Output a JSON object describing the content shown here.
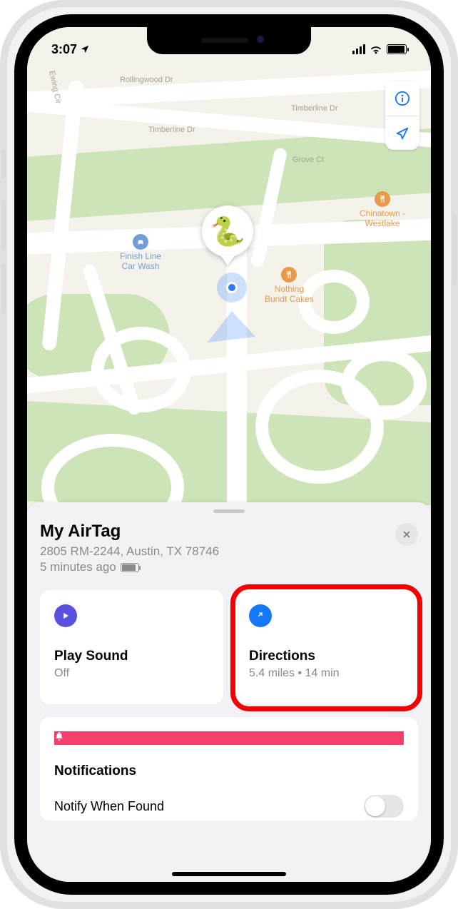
{
  "status": {
    "time": "3:07"
  },
  "map": {
    "roads": {
      "rollingwood": "Rollingwood Dr",
      "timberline": "Timberline Dr",
      "timberline2": "Timberline Dr",
      "grove": "Grove Ct",
      "ewing": "Ewing Cir"
    },
    "poi": {
      "carwash": "Finish Line\nCar Wash",
      "bundt": "Nothing\nBundt Cakes",
      "chinatown": "Chinatown -\nWestlake"
    },
    "marker_emoji": "🐍"
  },
  "sheet": {
    "title": "My AirTag",
    "address": "2805 RM-2244, Austin, TX  78746",
    "updated": "5 minutes ago"
  },
  "cards": {
    "play": {
      "title": "Play Sound",
      "sub": "Off"
    },
    "directions": {
      "title": "Directions",
      "sub": "5.4 miles • 14 min"
    },
    "notifications": {
      "title": "Notifications"
    },
    "notify_when_found": "Notify When Found"
  }
}
